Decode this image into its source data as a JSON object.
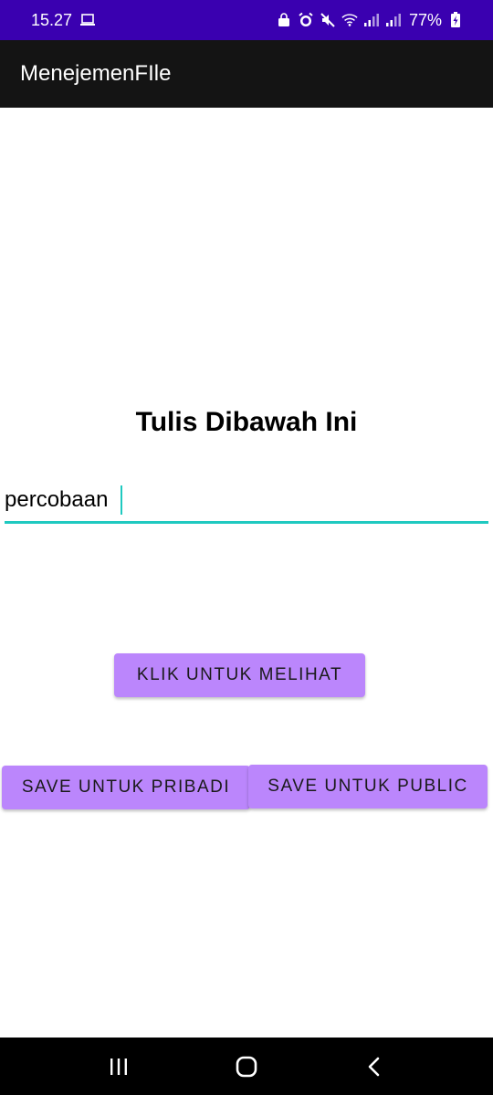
{
  "status_bar": {
    "time": "15.27",
    "battery": "77%",
    "background": "#3a00b0",
    "icons": [
      "laptop-icon",
      "lock-icon",
      "alarm-icon",
      "mute-icon",
      "wifi-icon",
      "signal-icon",
      "signal-icon",
      "battery-charging-icon"
    ]
  },
  "app_bar": {
    "title": "MenejemenFIle",
    "background": "#141414"
  },
  "main": {
    "heading": "Tulis Dibawah Ini",
    "input_value": "percobaan",
    "accent": "#1fc9c0",
    "view_button": "KLIK UNTUK MELIHAT",
    "save_private_button": "SAVE UNTUK PRIBADI",
    "save_public_button": "SAVE UNTUK PUBLIC",
    "button_color": "#bb86fc"
  },
  "nav_bar": {
    "icons": [
      "recent-apps-icon",
      "home-icon",
      "back-icon"
    ]
  }
}
